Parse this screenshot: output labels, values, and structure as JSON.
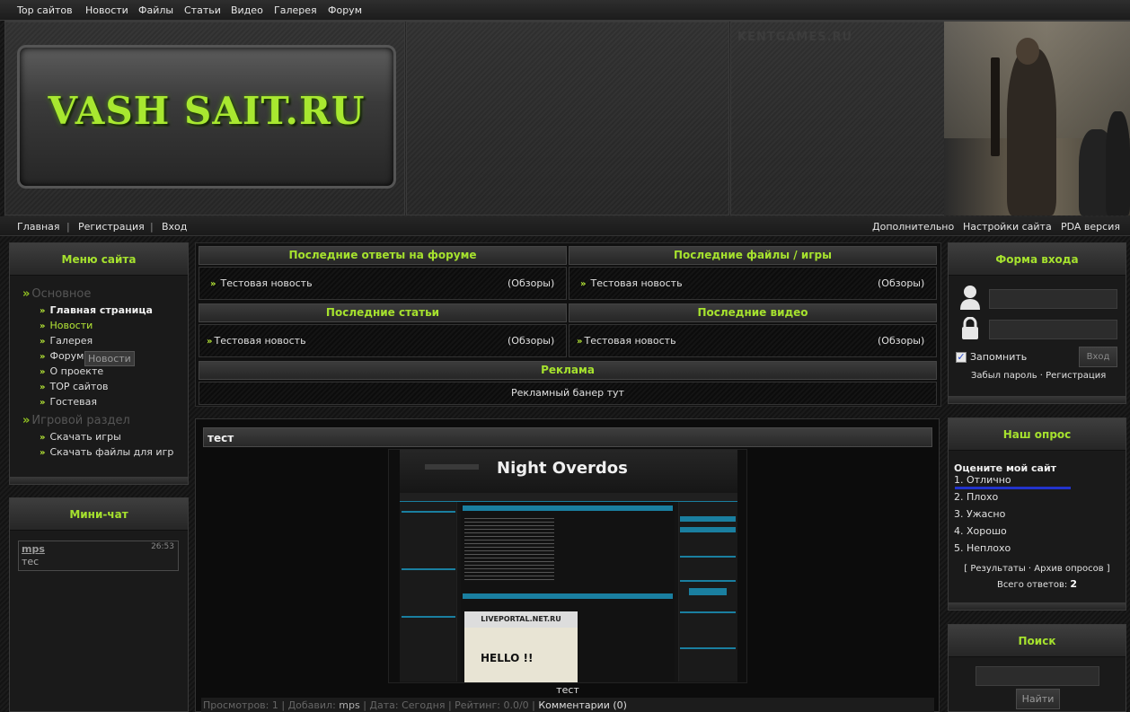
{
  "topnav": [
    "Top сайтов",
    "Новости",
    "Файлы",
    "Статьи",
    "Видео",
    "Галерея",
    "Форум"
  ],
  "header": {
    "logo": "VASH SAIT.RU",
    "watermark": "KENTGAMES.RU"
  },
  "subnav": {
    "left": [
      "Главная",
      "|",
      "Регистрация",
      "|",
      "Вход"
    ],
    "right": [
      "Дополнительно",
      "Настройки сайта",
      "PDA версия"
    ]
  },
  "site_menu": {
    "title": "Меню сайта",
    "section1": "Основное",
    "items1": [
      "Главная страница",
      "Новости",
      "Галерея",
      "Форум",
      "О проекте",
      "TOP сайтов",
      "Гостевая"
    ],
    "tooltip": "Новости",
    "section2": "Игровой раздел",
    "items2": [
      "Скачать игры",
      "Скачать файлы для игр"
    ]
  },
  "minichat": {
    "title": "Мини-чат",
    "user": "mps",
    "time": "26:53",
    "message": "тес"
  },
  "widgets": {
    "forum": {
      "title": "Последние ответы на форуме",
      "item": "Тестовая новость",
      "cat": "(Обзоры)"
    },
    "files": {
      "title": "Последние файлы / игры",
      "item": "Тестовая новость",
      "cat": "(Обзоры)"
    },
    "articles": {
      "title": "Последние статьи",
      "item": "Тестовая новость",
      "cat": "(Обзоры)"
    },
    "videos": {
      "title": "Последние видео",
      "item": "Тестовая новость",
      "cat": "(Обзоры)"
    },
    "ads": {
      "title": "Реклама",
      "text": "Рекламный банер тут"
    }
  },
  "news": {
    "title": "тест",
    "caption": "тест",
    "meta_views": "Просмотров: 1 | Добавил: ",
    "meta_author": "mps",
    "meta_rest": " | Дата: Сегодня | Рейтинг: 0.0/0 | ",
    "meta_comments": "Комментарии (0)",
    "screenshot": {
      "brand": "Night Overdos",
      "banner_text": "LIVEPORTAL.NET.RU",
      "hello": "HELLO !!"
    }
  },
  "login": {
    "title": "Форма входа",
    "remember": "Запомнить",
    "button": "Вход",
    "forgot": "Забыл пароль",
    "sep": "·",
    "register": "Регистрация"
  },
  "poll": {
    "title": "Наш опрос",
    "question": "Оцените мой сайт",
    "options": [
      "1. Отлично",
      "2. Плохо",
      "3. Ужасно",
      "4. Хорошо",
      "5. Неплохо"
    ],
    "results": "[ Результаты · Архив опросов ]",
    "total_label": "Всего ответов: ",
    "total": "2",
    "top_option_share": 1.0
  },
  "search": {
    "title": "Поиск",
    "button": "Найти"
  },
  "colors": {
    "accent": "#a6e22e",
    "bar": "#2233cc"
  }
}
